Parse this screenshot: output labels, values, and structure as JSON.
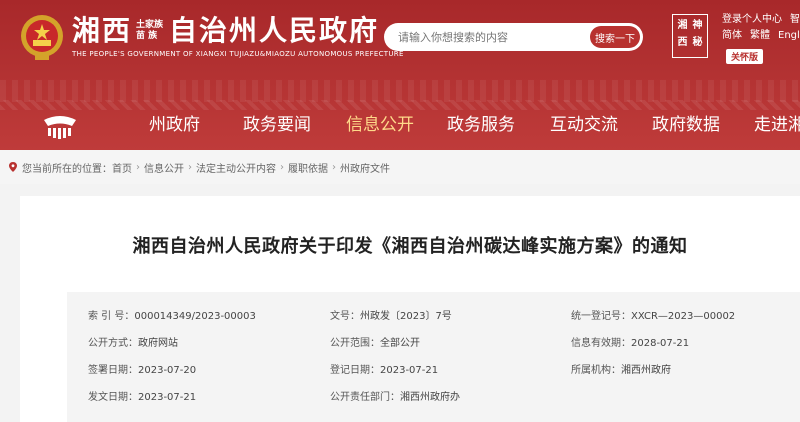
{
  "header": {
    "title_left": "湘西",
    "title_stack_top": "土家族",
    "title_stack_bottom": "苗  族",
    "title_right": "自治州人民政府",
    "subtitle": "THE PEOPLE'S GOVERNMENT OF XIANGXI TUJIAZU&MIAOZU AUTONOMOUS PREFECTURE",
    "search_placeholder": "请输入你想搜索的内容",
    "search_button": "搜索一下",
    "seal_chars": [
      "湘",
      "神",
      "西",
      "秘"
    ],
    "links_row1": [
      "登录个人中心",
      "智"
    ],
    "links_row2": [
      "简体",
      "繁體",
      "English"
    ],
    "care_mode": "关怀版",
    "colors": {
      "brand_red": "#b43333",
      "active_nav": "#ffd98a"
    }
  },
  "nav": {
    "items": [
      "州政府",
      "政务要闻",
      "信息公开",
      "政务服务",
      "互动交流",
      "政府数据",
      "走进湘"
    ],
    "active_index": 2
  },
  "breadcrumb": {
    "lead": "您当前所在的位置：",
    "items": [
      "首页",
      "信息公开",
      "法定主动公开内容",
      "履职依据",
      "州政府文件"
    ]
  },
  "article": {
    "title": "湘西自治州人民政府关于印发《湘西自治州碳达峰实施方案》的通知",
    "meta": [
      {
        "k": "索 引 号：",
        "v": "000014349/2023-00003"
      },
      {
        "k": "文号：",
        "v": "州政发〔2023〕7号"
      },
      {
        "k": "统一登记号：",
        "v": "XXCR—2023—00002"
      },
      {
        "k": "公开方式：",
        "v": "政府网站"
      },
      {
        "k": "公开范围：",
        "v": "全部公开"
      },
      {
        "k": "信息有效期：",
        "v": "2028-07-21"
      },
      {
        "k": "签署日期：",
        "v": "2023-07-20"
      },
      {
        "k": "登记日期：",
        "v": "2023-07-21"
      },
      {
        "k": "所属机构：",
        "v": "湘西州政府"
      },
      {
        "k": "发文日期：",
        "v": "2023-07-21"
      },
      {
        "k": "公开责任部门：",
        "v": "湘西州政府办"
      }
    ]
  }
}
